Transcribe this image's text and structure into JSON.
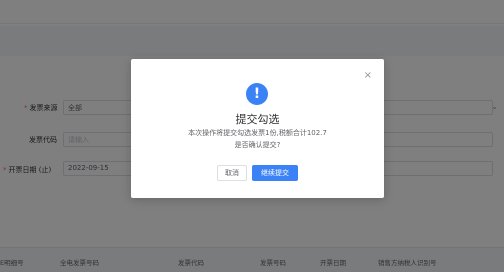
{
  "form": {
    "source_label": "发票来源",
    "source_value": "全部",
    "code_label": "发票代码",
    "code_placeholder": "请输入",
    "date_label": "开票日期",
    "date_hint": "(止)",
    "date_value": "2022-09-15"
  },
  "table": {
    "headers": [
      "全电发票号码",
      "发票代码",
      "发票号码",
      "开票日期",
      "销售方纳税人识别号"
    ],
    "first_col_partial": "E明细号"
  },
  "dialog": {
    "close_glyph": "×",
    "icon_glyph": "!",
    "title": "提交勾选",
    "message": "本次操作将提交勾选发票1份,税额合计102.7",
    "confirm_question": "是否确认提交?",
    "cancel_label": "取消",
    "ok_label": "继续提交"
  },
  "colors": {
    "primary": "#3b82f6",
    "mask": "rgba(0,0,0,0.5)"
  }
}
